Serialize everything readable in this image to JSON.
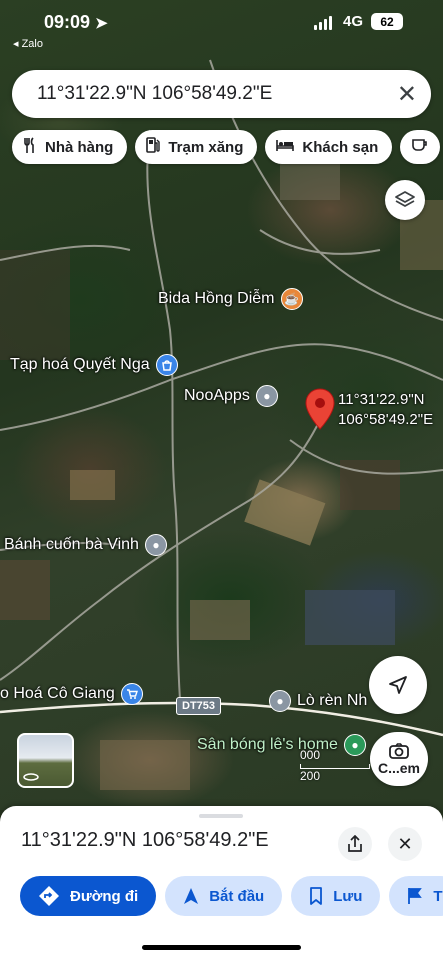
{
  "status_bar": {
    "time": "09:09",
    "back_app": "Zalo",
    "network": "4G",
    "battery": "62"
  },
  "search": {
    "query": "11°31'22.9\"N 106°58'49.2\"E"
  },
  "chips": [
    {
      "label": "Nhà hàng",
      "icon": "fork-knife-icon"
    },
    {
      "label": "Trạm xăng",
      "icon": "gas-station-icon"
    },
    {
      "label": "Khách sạn",
      "icon": "bed-icon"
    }
  ],
  "map": {
    "pois": [
      {
        "name": "Bida Hồng Diễm",
        "icon": "cafe-icon",
        "color": "#e8873a"
      },
      {
        "name": "Tạp hoá Quyết Nga",
        "icon": "shopping-bag-icon",
        "color": "#3a85e8"
      },
      {
        "name": "NooApps",
        "icon": "location-dot-icon",
        "color": "#8a96a3"
      },
      {
        "name": "Bánh cuốn bà Vinh",
        "icon": "location-dot-icon",
        "color": "#8a96a3"
      },
      {
        "name": "o Hoá Cô Giang",
        "icon": "shopping-cart-icon",
        "color": "#3a85e8"
      },
      {
        "name": "Lò rèn Nh",
        "icon": "location-dot-icon",
        "color": "#8a96a3"
      },
      {
        "name": "Sân bóng lê's home",
        "icon": "location-dot-icon",
        "color": "#2b9a5a"
      }
    ],
    "pin_label_line1": "11°31'22.9\"N",
    "pin_label_line2": "106°58'49.2\"E",
    "road_label": "DT753",
    "scale_label_top": "000",
    "scale_label_bottom": "200",
    "lens_label": "C...em"
  },
  "sheet": {
    "title": "11°31'22.9\"N 106°58'49.2\"E",
    "actions": [
      {
        "label": "Đường đi",
        "icon": "directions-icon"
      },
      {
        "label": "Bắt đầu",
        "icon": "navigation-arrow-icon"
      },
      {
        "label": "Lưu",
        "icon": "bookmark-icon"
      },
      {
        "label": "T",
        "icon": "flag-icon"
      }
    ]
  }
}
